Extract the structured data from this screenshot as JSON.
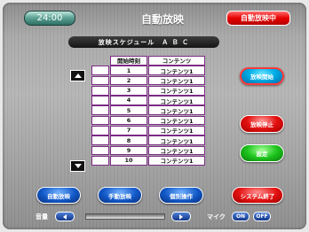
{
  "header": {
    "time": "24:00",
    "title": "自動放映",
    "status": "自動放映中"
  },
  "schedule": {
    "header": "放映スケジュール　Ａ Ｂ Ｃ",
    "columns": [
      "開始時刻",
      "コンテンツ"
    ],
    "rows": [
      {
        "no": "1",
        "content": "コンテンツ1"
      },
      {
        "no": "2",
        "content": "コンテンツ1"
      },
      {
        "no": "3",
        "content": "コンテンツ1"
      },
      {
        "no": "4",
        "content": "コンテンツ1"
      },
      {
        "no": "5",
        "content": "コンテンツ1"
      },
      {
        "no": "6",
        "content": "コンテンツ1"
      },
      {
        "no": "7",
        "content": "コンテンツ1"
      },
      {
        "no": "8",
        "content": "コンテンツ1"
      },
      {
        "no": "9",
        "content": "コンテンツ1"
      },
      {
        "no": "10",
        "content": "コンテンツ1"
      }
    ]
  },
  "side_buttons": {
    "start": "放映開始",
    "stop": "放映停止",
    "settings": "設定"
  },
  "bottom_buttons": {
    "auto": "自動放映",
    "manual": "手動放映",
    "individual": "個別操作",
    "shutdown": "システム終了"
  },
  "volume": {
    "label": "音量"
  },
  "mic": {
    "label": "マイク",
    "on": "ON",
    "off": "OFF"
  },
  "colors": {
    "table_border": "#7b2a83",
    "status_red": "#e60000",
    "start_blue": "#00aee8",
    "stop_red": "#e31010",
    "settings_green": "#1ec51e",
    "nav_blue": "#1158c7"
  }
}
